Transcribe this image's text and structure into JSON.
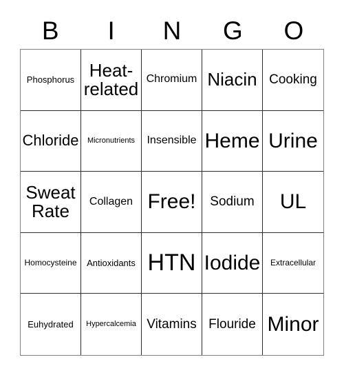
{
  "header": {
    "letters": [
      "B",
      "I",
      "N",
      "G",
      "O"
    ]
  },
  "grid": {
    "rows": [
      [
        {
          "label": "Phosphorus",
          "size": "fs-s"
        },
        {
          "label": "Heat-\nrelated",
          "size": "fs-xxl"
        },
        {
          "label": "Chromium",
          "size": "fs-m"
        },
        {
          "label": "Niacin",
          "size": "fs-xxl"
        },
        {
          "label": "Cooking",
          "size": "fs-l"
        }
      ],
      [
        {
          "label": "Chloride",
          "size": "fs-xl"
        },
        {
          "label": "Micronutrients",
          "size": "fs-xxs"
        },
        {
          "label": "Insensible",
          "size": "fs-m"
        },
        {
          "label": "Heme",
          "size": "fs-h1"
        },
        {
          "label": "Urine",
          "size": "fs-h1"
        }
      ],
      [
        {
          "label": "Sweat\nRate",
          "size": "fs-xxl"
        },
        {
          "label": "Collagen",
          "size": "fs-m"
        },
        {
          "label": "Free!",
          "size": "fs-h1"
        },
        {
          "label": "Sodium",
          "size": "fs-l"
        },
        {
          "label": "UL",
          "size": "fs-h1"
        }
      ],
      [
        {
          "label": "Homocysteine",
          "size": "fs-xs"
        },
        {
          "label": "Antioxidants",
          "size": "fs-s"
        },
        {
          "label": "HTN",
          "size": "fs-h2"
        },
        {
          "label": "Iodide",
          "size": "fs-h1"
        },
        {
          "label": "Extracellular",
          "size": "fs-xs"
        }
      ],
      [
        {
          "label": "Euhydrated",
          "size": "fs-s"
        },
        {
          "label": "Hypercalcemia",
          "size": "fs-xxs"
        },
        {
          "label": "Vitamins",
          "size": "fs-l"
        },
        {
          "label": "Flouride",
          "size": "fs-l"
        },
        {
          "label": "Minor",
          "size": "fs-h1"
        }
      ]
    ]
  }
}
